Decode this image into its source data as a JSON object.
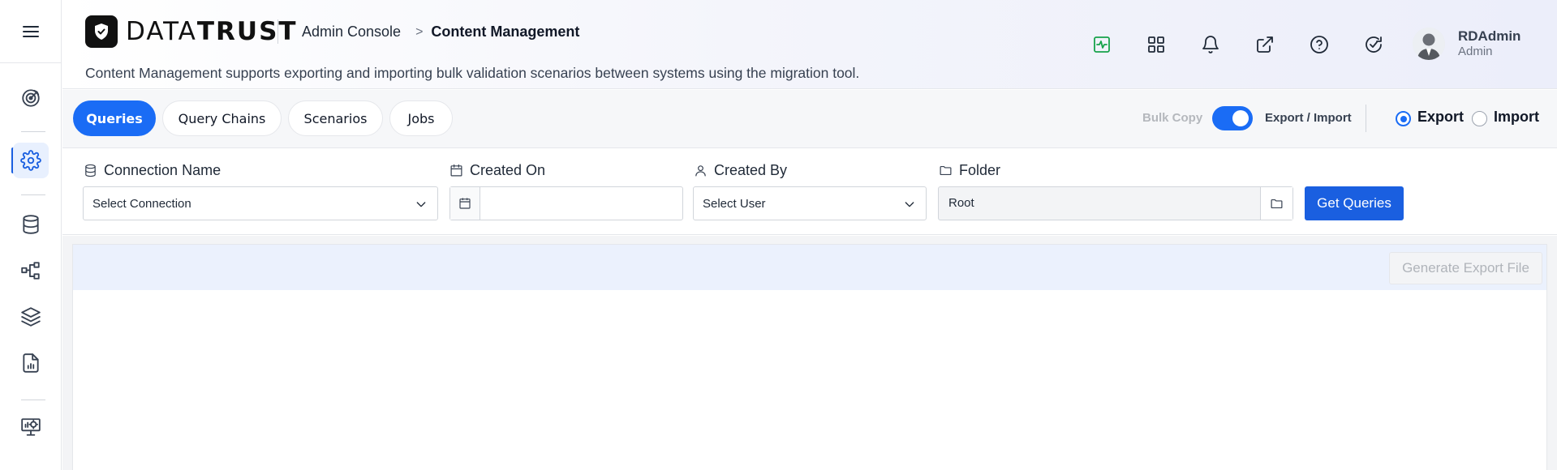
{
  "brand": {
    "name_light": "DATA",
    "name_bold": "TRUST"
  },
  "breadcrumb": {
    "root": "Admin Console",
    "separator": ">",
    "current": "Content Management"
  },
  "page": {
    "description": "Content Management supports exporting and importing bulk validation scenarios between systems using the migration tool."
  },
  "user": {
    "name": "RDAdmin",
    "role": "Admin"
  },
  "toolbar_icons": [
    "activity-icon",
    "apps-grid-icon",
    "bell-icon",
    "external-link-icon",
    "help-icon",
    "refresh-check-icon"
  ],
  "sidebar": {
    "items": [
      {
        "icon": "target-icon",
        "active": false
      },
      {
        "icon": "gear-icon",
        "active": true
      },
      {
        "icon": "database-icon",
        "active": false
      },
      {
        "icon": "hierarchy-icon",
        "active": false
      },
      {
        "icon": "layers-icon",
        "active": false
      },
      {
        "icon": "report-icon",
        "active": false
      },
      {
        "icon": "monitor-icon",
        "active": false
      }
    ]
  },
  "tabs": [
    {
      "label": "Queries",
      "active": true
    },
    {
      "label": "Query Chains",
      "active": false
    },
    {
      "label": "Scenarios",
      "active": false
    },
    {
      "label": "Jobs",
      "active": false
    }
  ],
  "mode": {
    "bulk_copy_label": "Bulk Copy",
    "toggle_on": true,
    "toggle_label": "Export / Import",
    "export_label": "Export",
    "import_label": "Import",
    "selected": "Export"
  },
  "filters": {
    "connection": {
      "label": "Connection Name",
      "value": "Select Connection"
    },
    "created_on": {
      "label": "Created On",
      "value": ""
    },
    "created_by": {
      "label": "Created By",
      "value": "Select User"
    },
    "folder": {
      "label": "Folder",
      "value": "Root"
    },
    "submit_label": "Get Queries"
  },
  "panel": {
    "generate_label": "Generate Export File"
  },
  "colors": {
    "accent": "#1a6cf5",
    "button": "#1a5fe0",
    "panel_header": "#ebf1fd",
    "activity_green": "#16a34a"
  }
}
